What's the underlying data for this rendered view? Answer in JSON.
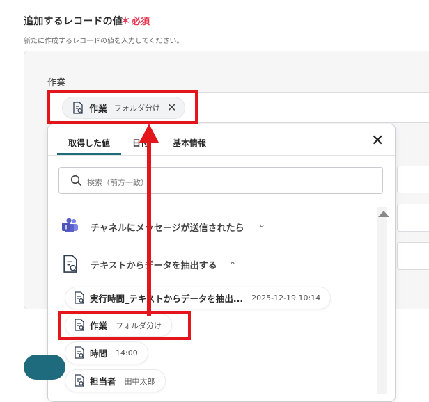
{
  "section": {
    "title": "追加するレコードの値",
    "required_mark": "＊",
    "required_label": "必須",
    "subtitle": "新たに作成するレコードの値を入力してください。"
  },
  "field": {
    "label": "作業",
    "chip": {
      "name": "作業",
      "sub": "フォルダ分け",
      "close": "✕"
    }
  },
  "popup": {
    "tabs": [
      {
        "label": "取得した値",
        "active": true
      },
      {
        "label": "日付",
        "active": false
      },
      {
        "label": "基本情報",
        "active": false
      }
    ],
    "close": "✕",
    "search_placeholder": "検索（前方一致）",
    "groups": [
      {
        "label": "チャネルにメッセージが送信されたら",
        "caret": "⌄",
        "icon": "teams-icon",
        "expanded": false
      },
      {
        "label": "テキストからデータを抽出する",
        "caret": "⌃",
        "icon": "document-search-icon",
        "expanded": true
      }
    ],
    "items": [
      {
        "name": "実行時間_テキストからデータを抽出...",
        "value": "2025-12-19 10:14"
      },
      {
        "name": "作業",
        "value": "フォルダ分け"
      },
      {
        "name": "時間",
        "value": "14:00"
      },
      {
        "name": "担当者",
        "value": "田中太郎"
      }
    ]
  },
  "colors": {
    "accent": "#1e6b7d",
    "highlight": "#e5161b",
    "required": "#e8344e",
    "teams": "#5b5fc7"
  }
}
